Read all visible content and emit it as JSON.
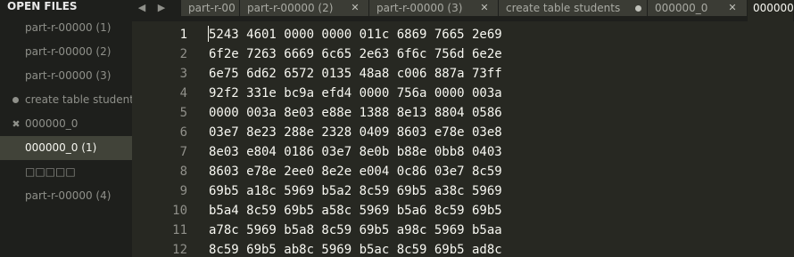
{
  "sidebar": {
    "title": "OPEN FILES",
    "items": [
      {
        "label": "part-r-00000 (1)",
        "marker": ""
      },
      {
        "label": "part-r-00000 (2)",
        "marker": ""
      },
      {
        "label": "part-r-00000 (3)",
        "marker": ""
      },
      {
        "label": "create table students(",
        "marker": "dot"
      },
      {
        "label": "000000_0",
        "marker": "✖"
      },
      {
        "label": "000000_0 (1)",
        "marker": "",
        "selected": true
      },
      {
        "label": "□□□□□",
        "marker": ""
      },
      {
        "label": "part-r-00000 (4)",
        "marker": ""
      }
    ]
  },
  "tabs": {
    "prev_arrow": "◀",
    "next_arrow": "▶",
    "items": [
      {
        "label": "part-r-00",
        "close": ""
      },
      {
        "label": "part-r-00000 (2)",
        "close": "✕"
      },
      {
        "label": "part-r-00000 (3)",
        "close": "✕"
      },
      {
        "label": "create table students(",
        "close": "dot"
      },
      {
        "label": "000000_0",
        "close": "✕"
      },
      {
        "label": "000000_0",
        "close": "",
        "active": true
      }
    ]
  },
  "editor": {
    "current_line": 1,
    "lines": [
      {
        "num": "1",
        "text": "5243 4601 0000 0000 011c 6869 7665 2e69"
      },
      {
        "num": "2",
        "text": "6f2e 7263 6669 6c65 2e63 6f6c 756d 6e2e"
      },
      {
        "num": "3",
        "text": "6e75 6d62 6572 0135 48a8 c006 887a 73ff"
      },
      {
        "num": "4",
        "text": "92f2 331e bc9a efd4 0000 756a 0000 003a"
      },
      {
        "num": "5",
        "text": "0000 003a 8e03 e88e 1388 8e13 8804 0586"
      },
      {
        "num": "6",
        "text": "03e7 8e23 288e 2328 0409 8603 e78e 03e8"
      },
      {
        "num": "7",
        "text": "8e03 e804 0186 03e7 8e0b b88e 0bb8 0403"
      },
      {
        "num": "8",
        "text": "8603 e78e 2ee0 8e2e e004 0c86 03e7 8c59"
      },
      {
        "num": "9",
        "text": "69b5 a18c 5969 b5a2 8c59 69b5 a38c 5969"
      },
      {
        "num": "10",
        "text": "b5a4 8c59 69b5 a58c 5969 b5a6 8c59 69b5"
      },
      {
        "num": "11",
        "text": "a78c 5969 b5a8 8c59 69b5 a98c 5969 b5aa"
      },
      {
        "num": "12",
        "text": "8c59 69b5 ab8c 5969 b5ac 8c59 69b5 ad8c"
      }
    ]
  }
}
